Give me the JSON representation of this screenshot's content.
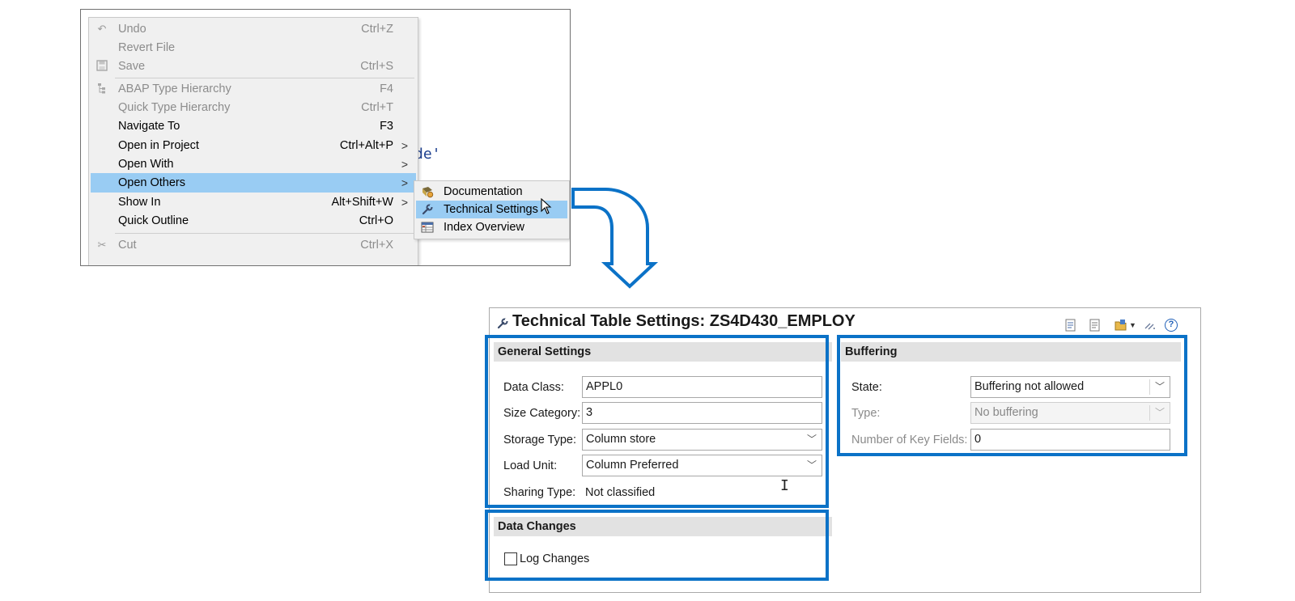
{
  "context_menu": {
    "items": [
      {
        "label": "Undo",
        "shortcut": "Ctrl+Z",
        "icon": "undo-icon",
        "disabled": true
      },
      {
        "label": "Revert File",
        "shortcut": "",
        "disabled": true
      },
      {
        "label": "Save",
        "shortcut": "Ctrl+S",
        "icon": "save-icon",
        "disabled": true
      },
      {
        "label": "ABAP Type Hierarchy",
        "shortcut": "F4",
        "icon": "hierarchy-icon",
        "disabled": true
      },
      {
        "label": "Quick Type Hierarchy",
        "shortcut": "Ctrl+T",
        "disabled": true
      },
      {
        "label": "Navigate To",
        "shortcut": "F3"
      },
      {
        "label": "Open in Project",
        "shortcut": "Ctrl+Alt+P",
        "submenu": ">"
      },
      {
        "label": "Open With",
        "shortcut": "",
        "submenu": ">"
      },
      {
        "label": "Open Others",
        "shortcut": "",
        "submenu": ">",
        "selected": true
      },
      {
        "label": "Show In",
        "shortcut": "Alt+Shift+W",
        "submenu": ">"
      },
      {
        "label": "Quick Outline",
        "shortcut": "Ctrl+O"
      },
      {
        "label": "Cut",
        "shortcut": "Ctrl+X",
        "icon": "scissors-icon",
        "disabled": true
      }
    ],
    "code_fragment": "de'"
  },
  "submenu": {
    "items": [
      {
        "label": "Documentation",
        "icon": "documentation-icon"
      },
      {
        "label": "Technical Settings",
        "icon": "wrench-icon",
        "selected": true
      },
      {
        "label": "Index Overview",
        "icon": "index-icon"
      }
    ]
  },
  "tech_settings": {
    "title": "Technical Table Settings: ZS4D430_EMPLOY",
    "general": {
      "heading": "General Settings",
      "data_class_label": "Data Class:",
      "data_class_value": "APPL0",
      "size_category_label": "Size Category:",
      "size_category_value": "3",
      "storage_type_label": "Storage Type:",
      "storage_type_value": "Column store",
      "load_unit_label": "Load Unit:",
      "load_unit_value": "Column Preferred",
      "sharing_type_label": "Sharing Type:",
      "sharing_type_value": "Not classified"
    },
    "data_changes": {
      "heading": "Data Changes",
      "log_changes_label": "Log Changes",
      "log_changes_checked": false
    },
    "buffering": {
      "heading": "Buffering",
      "state_label": "State:",
      "state_value": "Buffering not allowed",
      "type_label": "Type:",
      "type_value": "No buffering",
      "key_fields_label": "Number of Key Fields:",
      "key_fields_value": "0"
    }
  },
  "colors": {
    "highlight": "#0b72c7",
    "selection": "#99ccf3",
    "section_header": "#e2e2e2"
  }
}
